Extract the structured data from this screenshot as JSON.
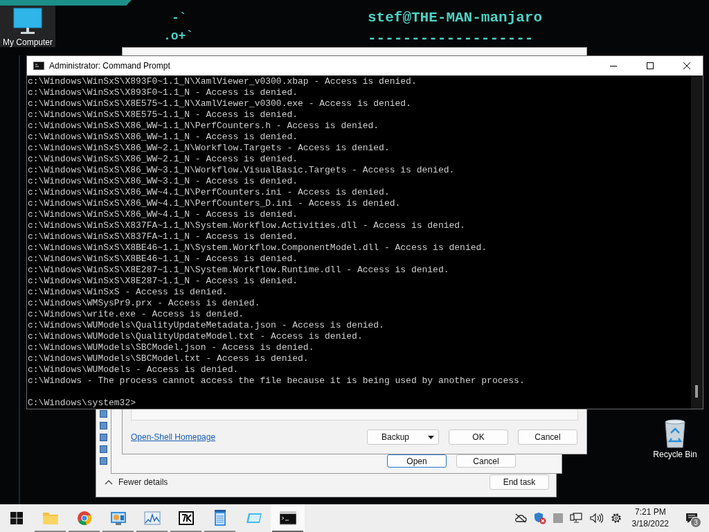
{
  "desktop": {
    "terminal": {
      "ascii_art": [
        "-`",
        ".o+`"
      ],
      "user_host": "stef@THE-MAN-manjaro",
      "separator": "-------------------"
    },
    "icons": [
      {
        "label": "My Computer",
        "kind": "computer"
      },
      {
        "label": "Recycle Bin",
        "kind": "recycle"
      }
    ]
  },
  "task_manager": {
    "toggle": "Fewer details",
    "button": "End task"
  },
  "open_dialog": {
    "buttons": [
      {
        "label": "Open",
        "default": true
      },
      {
        "label": "Cancel",
        "default": false
      }
    ]
  },
  "settings_window": {
    "link": "Open-Shell Homepage",
    "buttons": [
      {
        "label": "Backup",
        "kind": "dropdown"
      },
      {
        "label": "OK",
        "kind": "plain"
      },
      {
        "label": "Cancel",
        "kind": "plain"
      }
    ]
  },
  "cmd": {
    "title": "Administrator: Command Prompt",
    "lines": [
      "c:\\Windows\\WinSxS\\X893F0~1.1_N\\XamlViewer_v0300.xbap - Access is denied.",
      "c:\\Windows\\WinSxS\\X893F0~1.1_N - Access is denied.",
      "c:\\Windows\\WinSxS\\X8E575~1.1_N\\XamlViewer_v0300.exe - Access is denied.",
      "c:\\Windows\\WinSxS\\X8E575~1.1_N - Access is denied.",
      "c:\\Windows\\WinSxS\\X86_WW~1.1_N\\PerfCounters.h - Access is denied.",
      "c:\\Windows\\WinSxS\\X86_WW~1.1_N - Access is denied.",
      "c:\\Windows\\WinSxS\\X86_WW~2.1_N\\Workflow.Targets - Access is denied.",
      "c:\\Windows\\WinSxS\\X86_WW~2.1_N - Access is denied.",
      "c:\\Windows\\WinSxS\\X86_WW~3.1_N\\Workflow.VisualBasic.Targets - Access is denied.",
      "c:\\Windows\\WinSxS\\X86_WW~3.1_N - Access is denied.",
      "c:\\Windows\\WinSxS\\X86_WW~4.1_N\\PerfCounters.ini - Access is denied.",
      "c:\\Windows\\WinSxS\\X86_WW~4.1_N\\PerfCounters_D.ini - Access is denied.",
      "c:\\Windows\\WinSxS\\X86_WW~4.1_N - Access is denied.",
      "c:\\Windows\\WinSxS\\X837FA~1.1_N\\System.Workflow.Activities.dll - Access is denied.",
      "c:\\Windows\\WinSxS\\X837FA~1.1_N - Access is denied.",
      "c:\\Windows\\WinSxS\\X8BE46~1.1_N\\System.Workflow.ComponentModel.dll - Access is denied.",
      "c:\\Windows\\WinSxS\\X8BE46~1.1_N - Access is denied.",
      "c:\\Windows\\WinSxS\\X8E287~1.1_N\\System.Workflow.Runtime.dll - Access is denied.",
      "c:\\Windows\\WinSxS\\X8E287~1.1_N - Access is denied.",
      "c:\\Windows\\WinSxS - Access is denied.",
      "c:\\Windows\\WMSysPr9.prx - Access is denied.",
      "c:\\Windows\\write.exe - Access is denied.",
      "c:\\Windows\\WUModels\\QualityUpdateMetadata.json - Access is denied.",
      "c:\\Windows\\WUModels\\QualityUpdateModel.txt - Access is denied.",
      "c:\\Windows\\WUModels\\SBCModel.json - Access is denied.",
      "c:\\Windows\\WUModels\\SBCModel.txt - Access is denied.",
      "c:\\Windows\\WUModels - Access is denied.",
      "c:\\Windows - The process cannot access the file because it is being used by another process."
    ],
    "prompt": "C:\\Windows\\system32>"
  },
  "taskbar": {
    "apps": [
      {
        "kind": "explorer",
        "running": true,
        "active": false
      },
      {
        "kind": "chrome",
        "running": true,
        "active": false
      },
      {
        "kind": "control-panel",
        "running": true,
        "active": false
      },
      {
        "kind": "monitor",
        "running": true,
        "active": false
      },
      {
        "kind": "archiver",
        "running": true,
        "active": false
      },
      {
        "kind": "notepad",
        "running": true,
        "active": false
      },
      {
        "kind": "window-app",
        "running": false,
        "active": false
      },
      {
        "kind": "console",
        "running": true,
        "active": true
      }
    ],
    "clock": {
      "time": "7:21 PM",
      "date": "3/18/2022"
    },
    "notifications": "3"
  }
}
